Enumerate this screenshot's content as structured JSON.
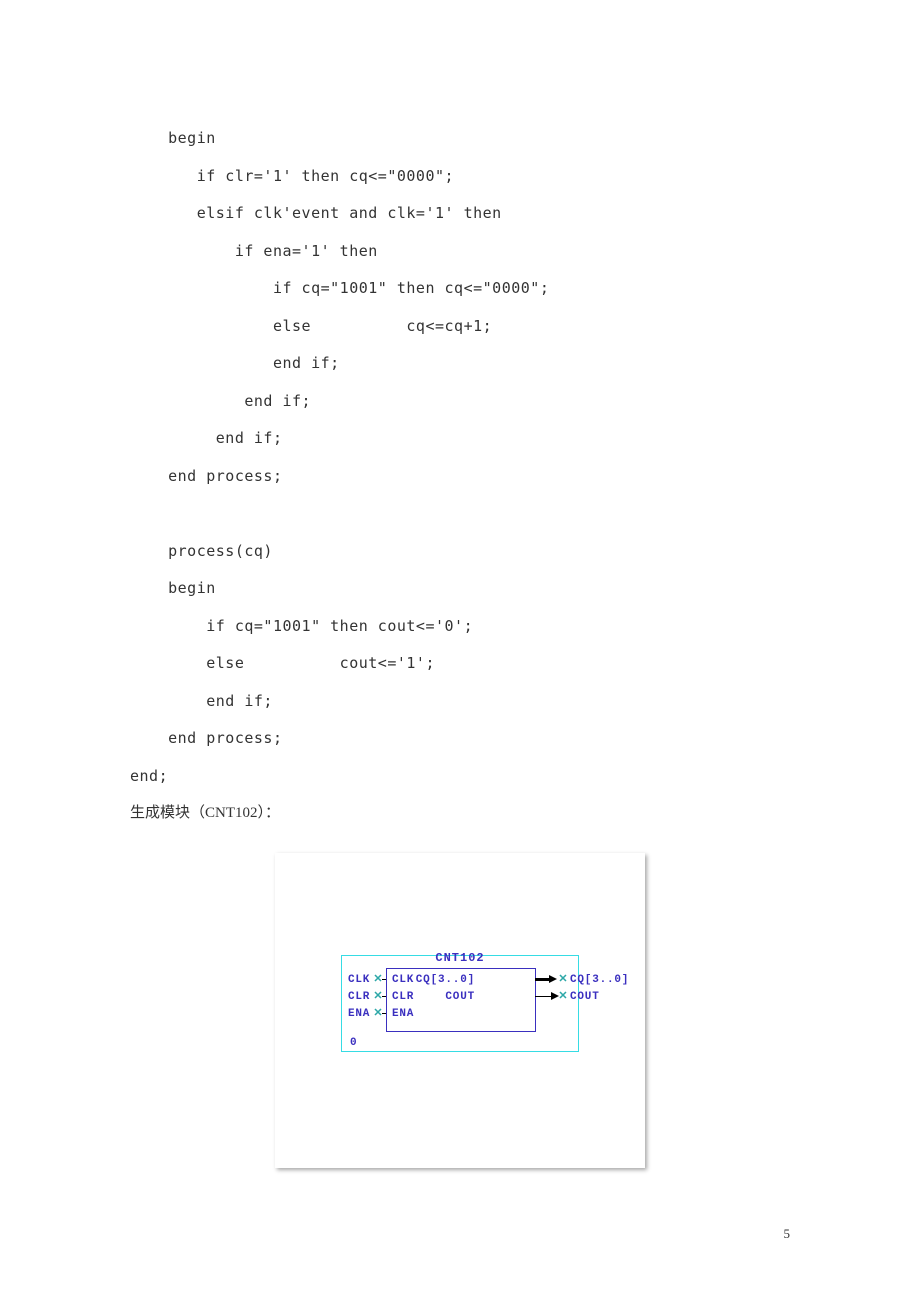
{
  "code_block": "    begin\n       if clr='1' then cq<=\"0000\";\n       elsif clk'event and clk='1' then\n           if ena='1' then\n               if cq=\"1001\" then cq<=\"0000\";\n               else          cq<=cq+1;\n               end if;\n            end if;\n         end if;\n    end process;\n\n    process(cq)\n    begin\n        if cq=\"1001\" then cout<='0';\n        else          cout<='1';\n        end if;\n    end process;\nend;",
  "caption": "生成模块（CNT102）：",
  "diagram": {
    "title": "CNT102",
    "inputs": [
      {
        "outer": "CLK",
        "inner": "CLK"
      },
      {
        "outer": "CLR",
        "inner": "CLR"
      },
      {
        "outer": "ENA",
        "inner": "ENA"
      }
    ],
    "outputs": [
      {
        "inner": "CQ[3..0]",
        "outer": "CQ[3..0]"
      },
      {
        "inner": "COUT",
        "outer": "COUT"
      }
    ],
    "instance": "0"
  },
  "page_number": "5"
}
